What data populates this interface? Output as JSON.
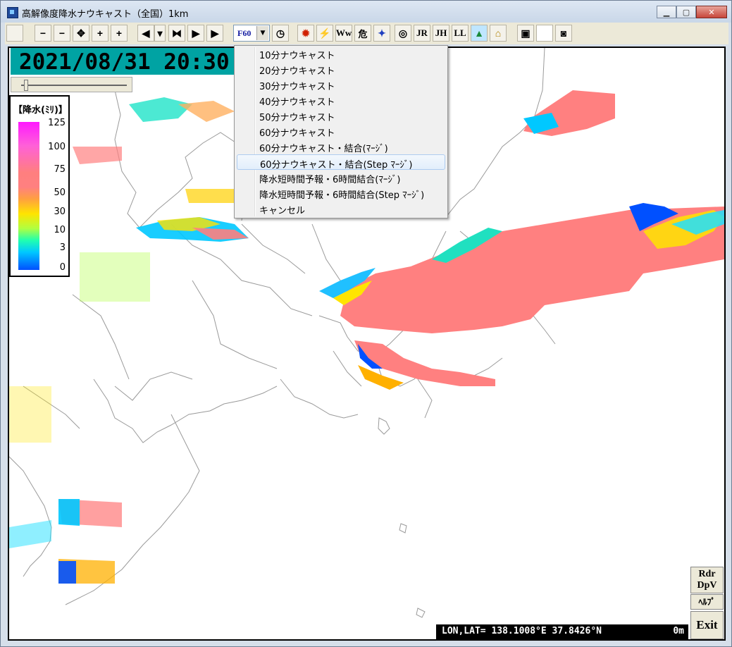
{
  "window": {
    "title": "高解像度降水ナウキャスト（全国）1km"
  },
  "toolbar": {
    "buttons": [
      {
        "name": "japan-map-button",
        "label": ""
      },
      {
        "name": "zoom-out-button",
        "label": "−"
      },
      {
        "name": "zoom-out-filled-button",
        "label": "−"
      },
      {
        "name": "center-button",
        "label": "✥"
      },
      {
        "name": "zoom-in-filled-button",
        "label": "+"
      },
      {
        "name": "zoom-in-button",
        "label": "+"
      },
      {
        "name": "prev-button",
        "label": "◀"
      },
      {
        "name": "prev-dropdown-button",
        "label": "▾"
      },
      {
        "name": "stop-button",
        "label": "⧓"
      },
      {
        "name": "next-button",
        "label": "▶"
      },
      {
        "name": "play-button",
        "label": "▶"
      }
    ],
    "combo_value": "F60",
    "right_buttons": [
      {
        "name": "clock-button",
        "label": "◷"
      },
      {
        "name": "radar-button",
        "label": "✹"
      },
      {
        "name": "lightning-button",
        "label": "⚡"
      },
      {
        "name": "ww-button",
        "label": "Ww"
      },
      {
        "name": "danger-button",
        "label": "危"
      },
      {
        "name": "satellite-button",
        "label": "✦"
      },
      {
        "name": "target-button",
        "label": "◎"
      },
      {
        "name": "jr-button",
        "label": "JR"
      },
      {
        "name": "jh-button",
        "label": "JH"
      },
      {
        "name": "ll-button",
        "label": "LL"
      },
      {
        "name": "terrain-button",
        "label": "▲"
      },
      {
        "name": "open-button",
        "label": "⌂"
      },
      {
        "name": "save-button",
        "label": "▣"
      },
      {
        "name": "blank-button",
        "label": ""
      },
      {
        "name": "camera-button",
        "label": "◙"
      }
    ]
  },
  "map": {
    "datetime": "2021/08/31 20:30",
    "status": {
      "coords": "LON,LAT= 138.1008°E  37.8426°N",
      "elevation": "0m"
    }
  },
  "legend": {
    "title": "【降水(ﾐﾘ)】",
    "ticks": [
      "125",
      "100",
      "75",
      "50",
      "30",
      "10",
      "3",
      "0"
    ]
  },
  "menu": {
    "items": [
      "10分ナウキャスト",
      "20分ナウキャスト",
      "30分ナウキャスト",
      "40分ナウキャスト",
      "50分ナウキャスト",
      "60分ナウキャスト",
      "60分ナウキャスト・結合(ﾏｰｼﾞ)",
      "60分ナウキャスト・結合(Step ﾏｰｼﾞ)",
      "降水短時間予報・6時間結合(ﾏｰｼﾞ)",
      "降水短時間予報・6時間結合(Step ﾏｰｼﾞ)",
      "キャンセル"
    ],
    "highlighted_index": 7
  },
  "side": {
    "rdr": "Rdr",
    "dpv": "DpV",
    "help": "ﾍﾙﾌﾟ",
    "exit": "Exit"
  },
  "colors": {
    "date_bg": "#00a3a3",
    "rain_heavy": "#ff8080",
    "rain_light": "#0050ff"
  }
}
